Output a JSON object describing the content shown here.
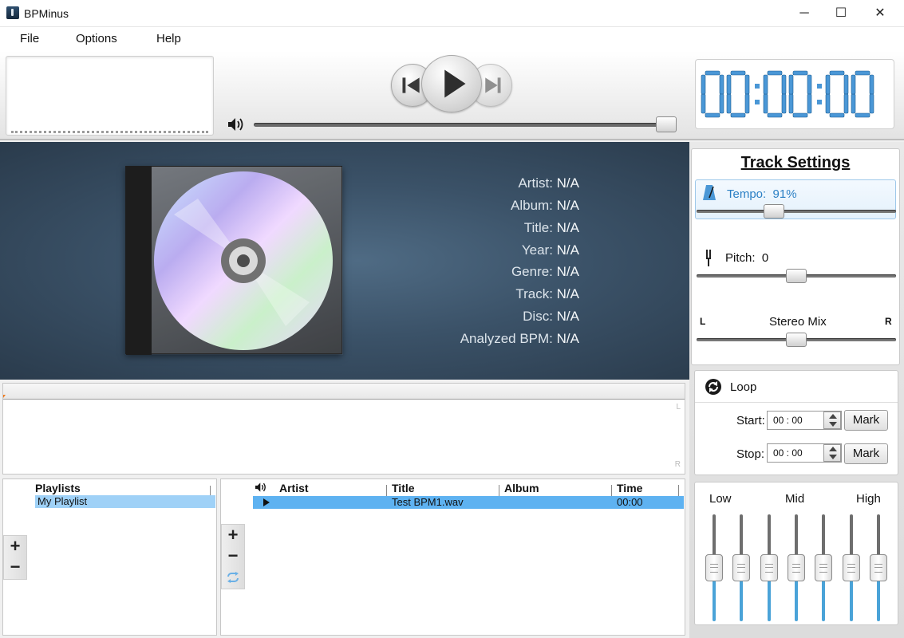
{
  "window": {
    "title": "BPMinus",
    "controls": {
      "minimize": "─",
      "maximize": "☐",
      "close": "✕"
    }
  },
  "menu": [
    "File",
    "Options",
    "Help"
  ],
  "player": {
    "time": "00:00:00",
    "volume_fraction": 0.96
  },
  "metadata": [
    {
      "key": "Artist:",
      "value": "N/A"
    },
    {
      "key": "Album:",
      "value": "N/A"
    },
    {
      "key": "Title:",
      "value": "N/A"
    },
    {
      "key": "Year:",
      "value": "N/A"
    },
    {
      "key": "Genre:",
      "value": "N/A"
    },
    {
      "key": "Track:",
      "value": "N/A"
    },
    {
      "key": "Disc:",
      "value": "N/A"
    },
    {
      "key": "Analyzed BPM:",
      "value": "N/A"
    }
  ],
  "track_settings": {
    "title": "Track Settings",
    "tempo_label": "Tempo:",
    "tempo_value": "91%",
    "pitch_label": "Pitch:",
    "pitch_value": "0",
    "stereo_label": "Stereo Mix",
    "stereo_left": "L",
    "stereo_right": "R"
  },
  "loop": {
    "label": "Loop",
    "start_label": "Start:",
    "start_value": "00 : 00",
    "stop_label": "Stop:",
    "stop_value": "00 : 00",
    "mark_label": "Mark"
  },
  "eq": {
    "labels": [
      "Low",
      "Mid",
      "High"
    ],
    "bands": 7
  },
  "waveform": {
    "left": "L",
    "right": "R"
  },
  "playlists": {
    "header": "Playlists",
    "items": [
      "My Playlist"
    ]
  },
  "tracks": {
    "columns": [
      "Artist",
      "Title",
      "Album",
      "Time"
    ],
    "rows": [
      {
        "artist": "",
        "title": "Test BPM1.wav",
        "album": "",
        "time": "00:00"
      }
    ]
  },
  "buttons": {
    "add": "+",
    "remove": "−"
  },
  "colors": {
    "accent": "#5eb2f1",
    "selection": "#9fd1f7",
    "clock": "#4a97d6",
    "eq_active": "#4aa3d8"
  }
}
